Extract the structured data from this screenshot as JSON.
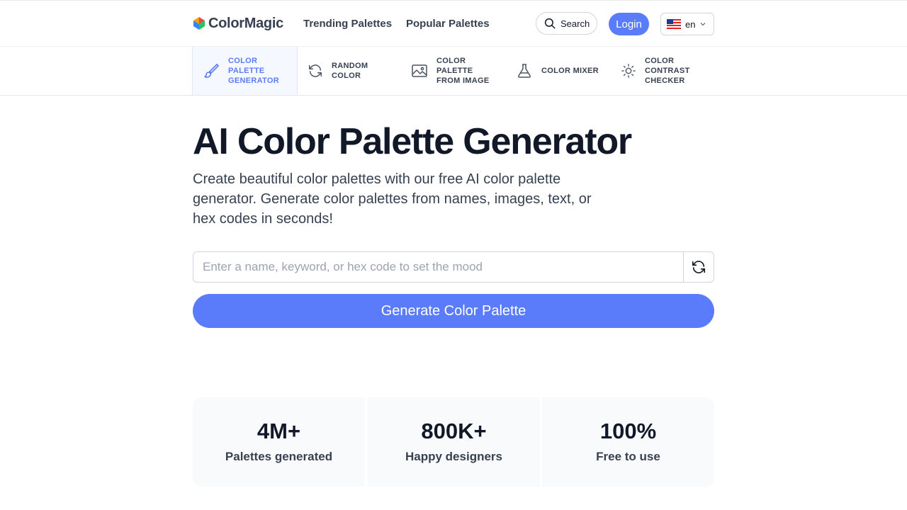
{
  "header": {
    "logo_text": "ColorMagic",
    "nav": [
      {
        "label": "Trending Palettes"
      },
      {
        "label": "Popular Palettes"
      }
    ],
    "search_label": "Search",
    "login_label": "Login",
    "language": {
      "code": "en",
      "flag": "us-flag-icon"
    }
  },
  "tools": [
    {
      "label": "Color Palette Generator",
      "icon": "brush-icon",
      "active": true
    },
    {
      "label": "Random Color",
      "icon": "refresh-icon",
      "active": false
    },
    {
      "label": "Color Palette from Image",
      "icon": "image-icon",
      "active": false
    },
    {
      "label": "Color Mixer",
      "icon": "flask-icon",
      "active": false
    },
    {
      "label": "Color Contrast Checker",
      "icon": "sun-icon",
      "active": false
    }
  ],
  "hero": {
    "title": "AI Color Palette Generator",
    "subtitle": "Create beautiful color palettes with our free AI color palette generator. Generate color palettes from names, images, text, or hex codes in seconds!"
  },
  "input": {
    "value": "",
    "placeholder": "Enter a name, keyword, or hex code to set the mood"
  },
  "generate_label": "Generate Color Palette",
  "stats": [
    {
      "value": "4M+",
      "label": "Palettes generated"
    },
    {
      "value": "800K+",
      "label": "Happy designers"
    },
    {
      "value": "100%",
      "label": "Free to use"
    }
  ],
  "colors": {
    "accent": "#5b7cfa",
    "text_dark": "#111827",
    "text_muted": "#374151",
    "stat_bg": "#f9fafb"
  }
}
